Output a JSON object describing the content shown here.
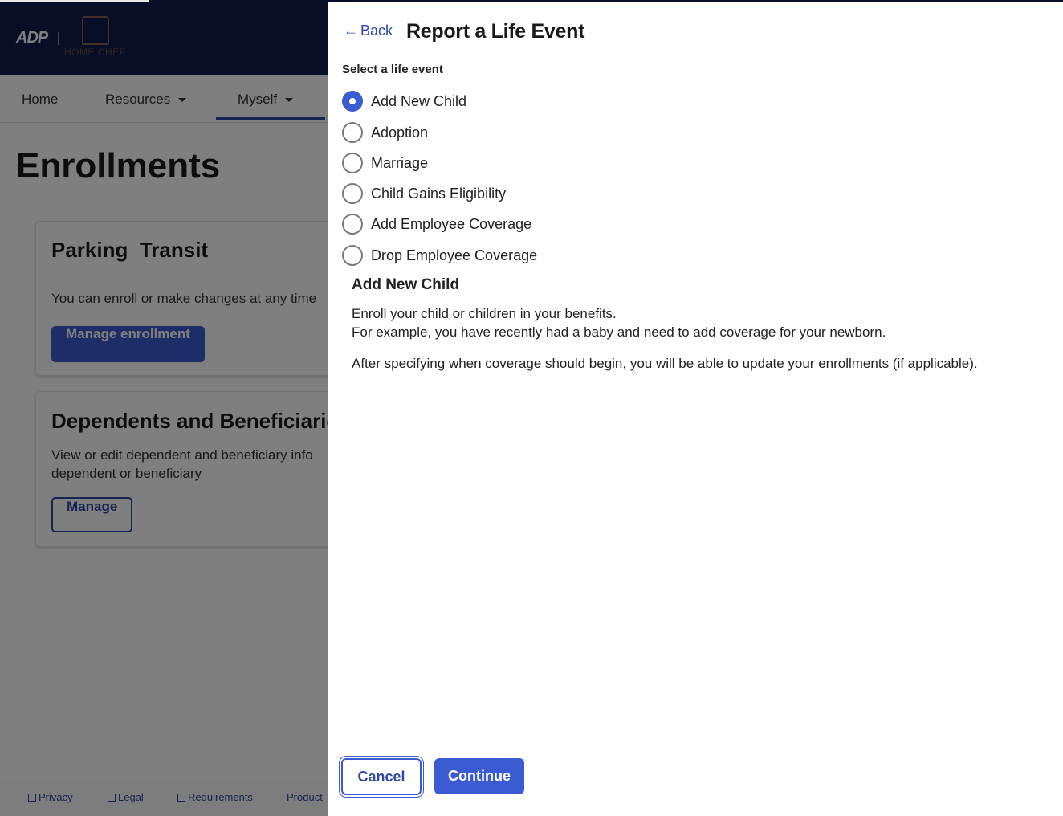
{
  "background": {
    "brand": {
      "logo": "ADP",
      "company": "HOME CHEF"
    },
    "nav": {
      "home": "Home",
      "resources": "Resources",
      "myself": "Myself"
    },
    "page_title": "Enrollments",
    "cards": [
      {
        "title": "Parking_Transit",
        "text": "You can enroll or make changes at any time",
        "button": "Manage enrollment"
      },
      {
        "title": "Dependents and Beneficiaries",
        "text_line1": "View or edit dependent and beneficiary info",
        "text_line2": "dependent or beneficiary",
        "button": "Manage"
      }
    ],
    "footer": {
      "privacy": "Privacy",
      "legal": "Legal",
      "requirements": "Requirements",
      "product": "Product"
    }
  },
  "panel": {
    "back_label": "Back",
    "title": "Report a Life Event",
    "section_label": "Select a life event",
    "options": [
      {
        "label": "Add New Child",
        "checked": true
      },
      {
        "label": "Adoption",
        "checked": false
      },
      {
        "label": "Marriage",
        "checked": false
      },
      {
        "label": "Child Gains Eligibility",
        "checked": false
      },
      {
        "label": "Add Employee Coverage",
        "checked": false
      },
      {
        "label": "Drop Employee Coverage",
        "checked": false
      }
    ],
    "description": {
      "title": "Add New Child",
      "line1": "Enroll your child or children in your benefits.",
      "line2": "For example, you have recently had a baby and need to add coverage for your newborn.",
      "line3": "After specifying when coverage should begin, you will be able to update your enrollments (if applicable)."
    },
    "buttons": {
      "cancel": "Cancel",
      "continue": "Continue"
    }
  },
  "colors": {
    "brand_navy": "#121c4e",
    "accent": "#3a5bd1",
    "link": "#2e48a6"
  }
}
